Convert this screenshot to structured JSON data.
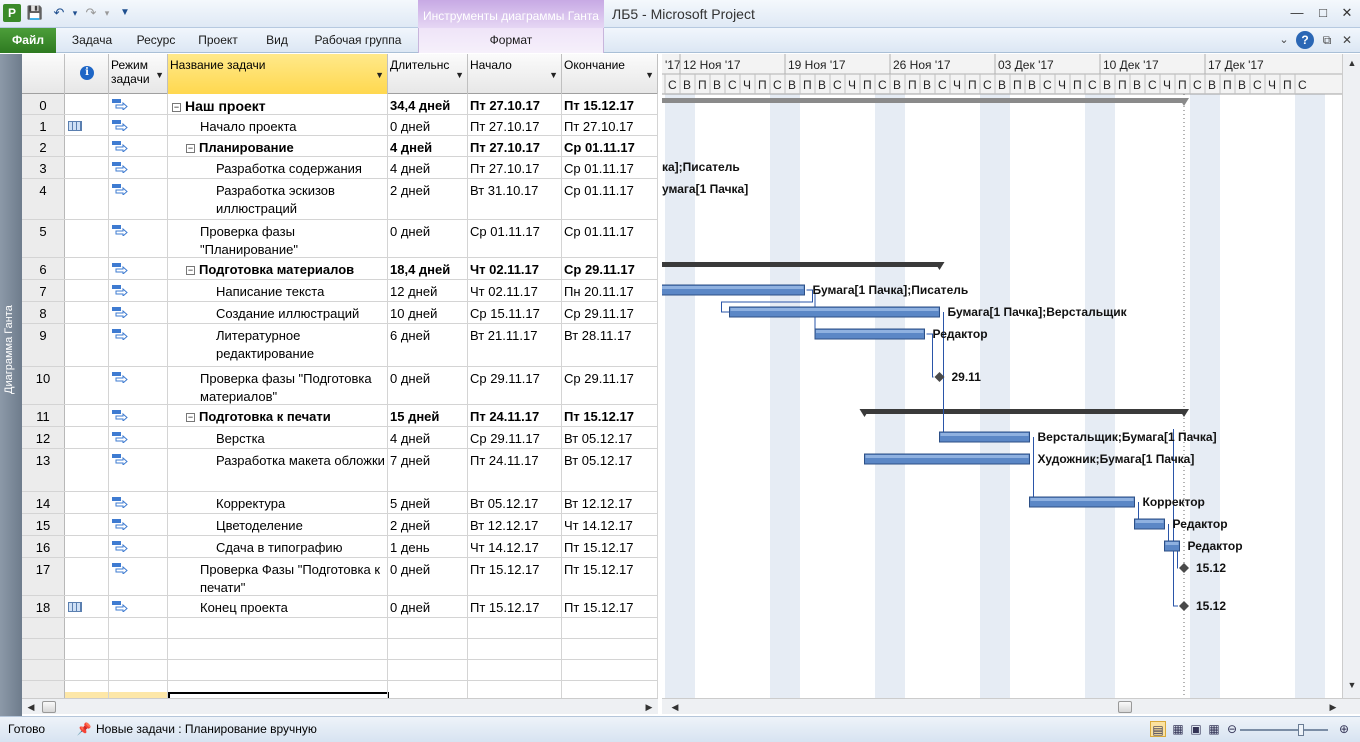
{
  "window": {
    "app_icon": "P",
    "title": "ЛБ5  -  Microsoft Project",
    "context_tab_title": "Инструменты диаграммы Ганта"
  },
  "ribbon": {
    "file": "Файл",
    "tabs": [
      "Задача",
      "Ресурс",
      "Проект",
      "Вид",
      "Рабочая группа",
      "Формат"
    ]
  },
  "view_bar": {
    "label": "Диаграмма Ганта"
  },
  "columns": {
    "info": "i",
    "mode": "Режим задачи",
    "name": "Название задачи",
    "duration": "Длительнс",
    "start": "Начало",
    "finish": "Окончание"
  },
  "tasks": [
    {
      "id": "0",
      "name": "Наш проект",
      "duration": "34,4 дней",
      "start": "Пт 27.10.17",
      "finish": "Пт 15.12.17",
      "level": 0,
      "summary": true,
      "top": true
    },
    {
      "id": "1",
      "name": "Начало проекта",
      "duration": "0 дней",
      "start": "Пт 27.10.17",
      "finish": "Пт 27.10.17",
      "level": 1,
      "indicator": "calendar"
    },
    {
      "id": "2",
      "name": "Планирование",
      "duration": "4 дней",
      "start": "Пт 27.10.17",
      "finish": "Ср 01.11.17",
      "level": 1,
      "summary": true
    },
    {
      "id": "3",
      "name": "Разработка содержания",
      "duration": "4 дней",
      "start": "Пт 27.10.17",
      "finish": "Ср 01.11.17",
      "level": 2
    },
    {
      "id": "4",
      "name": "Разработка эскизов иллюстраций",
      "duration": "2 дней",
      "start": "Вт 31.10.17",
      "finish": "Ср 01.11.17",
      "level": 2
    },
    {
      "id": "5",
      "name": "Проверка фазы \"Планирование\"",
      "duration": "0 дней",
      "start": "Ср 01.11.17",
      "finish": "Ср 01.11.17",
      "level": 1
    },
    {
      "id": "6",
      "name": "Подготовка материалов",
      "duration": "18,4 дней",
      "start": "Чт 02.11.17",
      "finish": "Ср 29.11.17",
      "level": 1,
      "summary": true
    },
    {
      "id": "7",
      "name": "Написание текста",
      "duration": "12 дней",
      "start": "Чт 02.11.17",
      "finish": "Пн 20.11.17",
      "level": 2
    },
    {
      "id": "8",
      "name": "Создание иллюстраций",
      "duration": "10 дней",
      "start": "Ср 15.11.17",
      "finish": "Ср 29.11.17",
      "level": 2
    },
    {
      "id": "9",
      "name": "Литературное редактирование",
      "duration": "6 дней",
      "start": "Вт 21.11.17",
      "finish": "Вт 28.11.17",
      "level": 2
    },
    {
      "id": "10",
      "name": "Проверка фазы \"Подготовка материалов\"",
      "duration": "0 дней",
      "start": "Ср 29.11.17",
      "finish": "Ср 29.11.17",
      "level": 1
    },
    {
      "id": "11",
      "name": "Подготовка к печати",
      "duration": "15 дней",
      "start": "Пт 24.11.17",
      "finish": "Пт 15.12.17",
      "level": 1,
      "summary": true
    },
    {
      "id": "12",
      "name": "Верстка",
      "duration": "4 дней",
      "start": "Ср 29.11.17",
      "finish": "Вт 05.12.17",
      "level": 2
    },
    {
      "id": "13",
      "name": "Разработка макета обложки",
      "duration": "7 дней",
      "start": "Пт 24.11.17",
      "finish": "Вт 05.12.17",
      "level": 2
    },
    {
      "id": "14",
      "name": "Корректура",
      "duration": "5 дней",
      "start": "Вт 05.12.17",
      "finish": "Вт 12.12.17",
      "level": 2
    },
    {
      "id": "15",
      "name": "Цветоделение",
      "duration": "2 дней",
      "start": "Вт 12.12.17",
      "finish": "Чт 14.12.17",
      "level": 2
    },
    {
      "id": "16",
      "name": "Сдача в типографию",
      "duration": "1 день",
      "start": "Чт 14.12.17",
      "finish": "Пт 15.12.17",
      "level": 2
    },
    {
      "id": "17",
      "name": "Проверка Фазы \"Подготовка к печати\"",
      "duration": "0 дней",
      "start": "Пт 15.12.17",
      "finish": "Пт 15.12.17",
      "level": 1
    },
    {
      "id": "18",
      "name": "Конец проекта",
      "duration": "0 дней",
      "start": "Пт 15.12.17",
      "finish": "Пт 15.12.17",
      "level": 1,
      "indicator": "calendar"
    }
  ],
  "timescale": {
    "weeks": [
      "'17",
      "12 Ноя '17",
      "19 Ноя '17",
      "26 Ноя '17",
      "03 Дек '17",
      "10 Дек '17",
      "17 Дек '17"
    ],
    "day_letters": [
      "В",
      "П",
      "В",
      "С",
      "Ч",
      "П",
      "С"
    ],
    "first_week_days": [
      "С",
      "Ч",
      "П",
      "С"
    ]
  },
  "bar_labels": {
    "3": "ка];Писатель",
    "4": "умага[1 Пачка]",
    "7": "Бумага[1 Пачка];Писатель",
    "8": "Бумага[1 Пачка];Верстальщик",
    "9": "Редактор",
    "10": "29.11",
    "12": "Верстальщик;Бумага[1 Пачка]",
    "13": "Художник;Бумага[1 Пачка]",
    "14": "Корректор",
    "15": "Редактор",
    "16": "Редактор",
    "17": "15.12",
    "18": "15.12"
  },
  "status": {
    "ready": "Готово",
    "new_tasks": "Новые задачи : Планирование вручную"
  },
  "colors": {
    "bar_fill": "#5b87c6",
    "summary_bar": "#3a3a3a",
    "nonworking": "#e6ecf4",
    "link": "#2a55a8",
    "selected_row": "#ffd04f"
  }
}
